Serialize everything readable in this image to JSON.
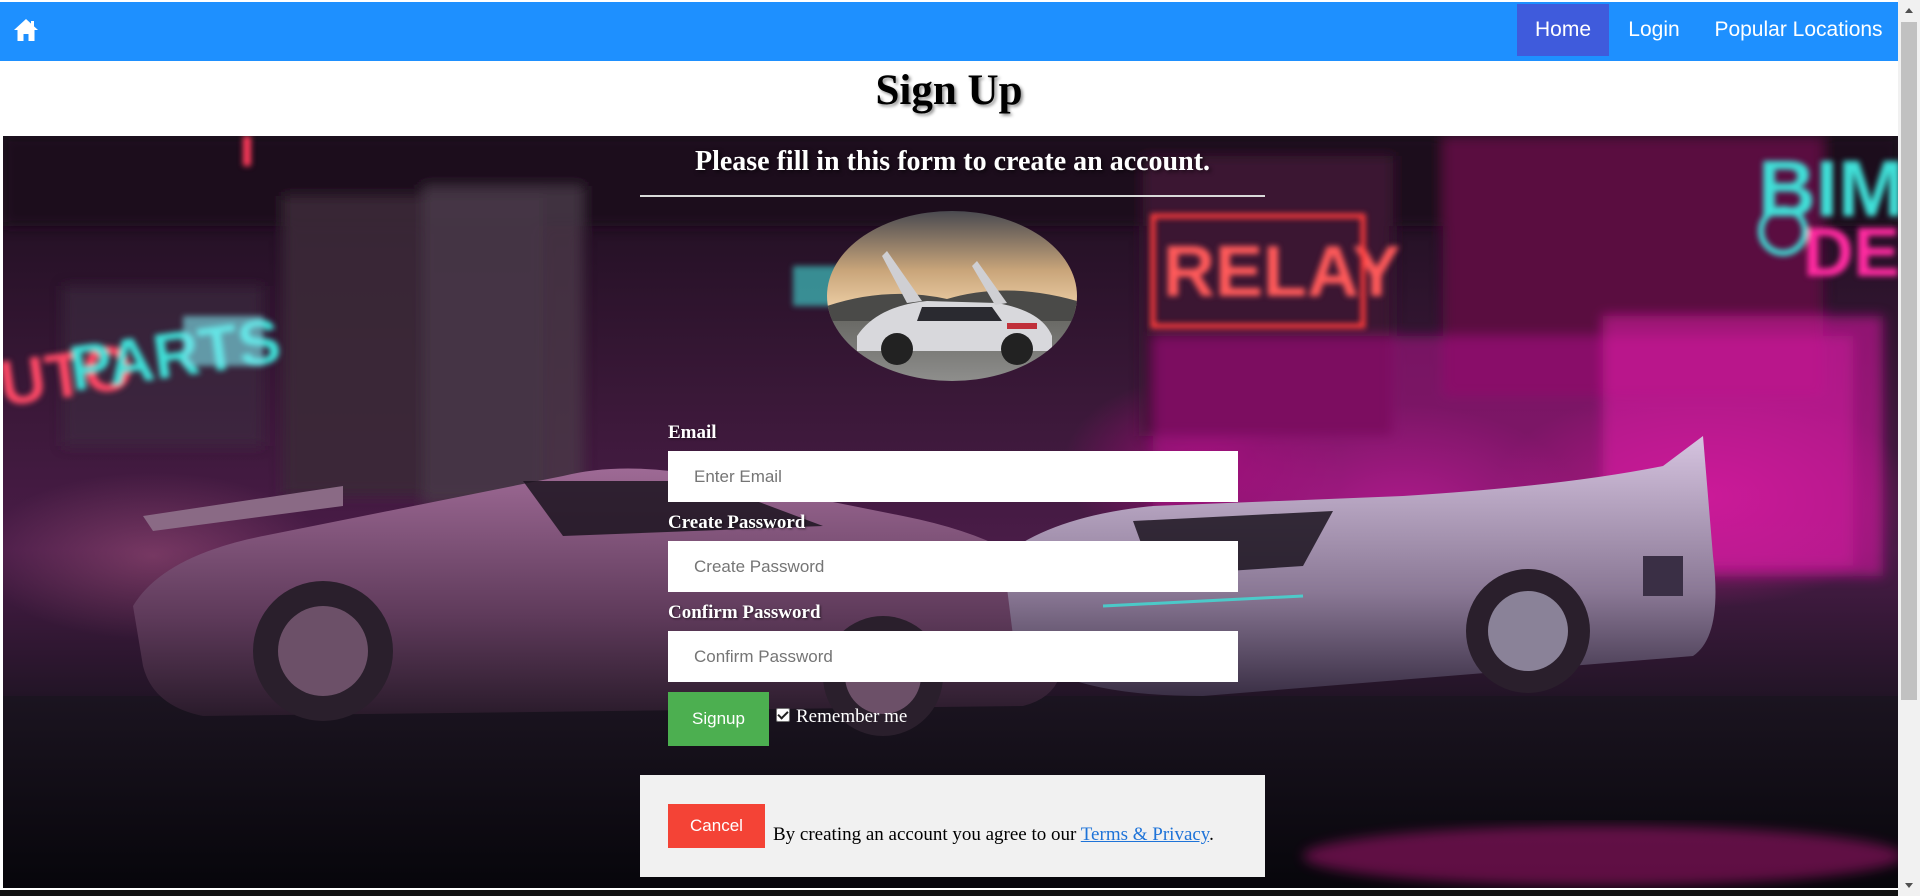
{
  "nav": {
    "home_icon": "home-icon",
    "items": [
      {
        "label": "Home",
        "active": true
      },
      {
        "label": "Login",
        "active": false
      },
      {
        "label": "Popular Locations",
        "active": false
      }
    ],
    "background_color": "#1e90ff",
    "active_color": "#3f5bdc"
  },
  "page": {
    "title": "Sign Up"
  },
  "form": {
    "subtitle": "Please fill in this form to create an account.",
    "email": {
      "label": "Email",
      "placeholder": "Enter Email",
      "value": ""
    },
    "password": {
      "label": "Create Password",
      "placeholder": "Create Password",
      "value": ""
    },
    "confirm": {
      "label": "Confirm Password",
      "placeholder": "Confirm Password",
      "value": ""
    },
    "signup_label": "Signup",
    "remember_label": "Remember me",
    "remember_checked": true,
    "cancel_label": "Cancel",
    "agree_text": "By creating an account you agree to our",
    "terms_link": "Terms & Privacy",
    "agree_end": ".",
    "signup_color": "#4caf50",
    "cancel_color": "#f44336"
  }
}
